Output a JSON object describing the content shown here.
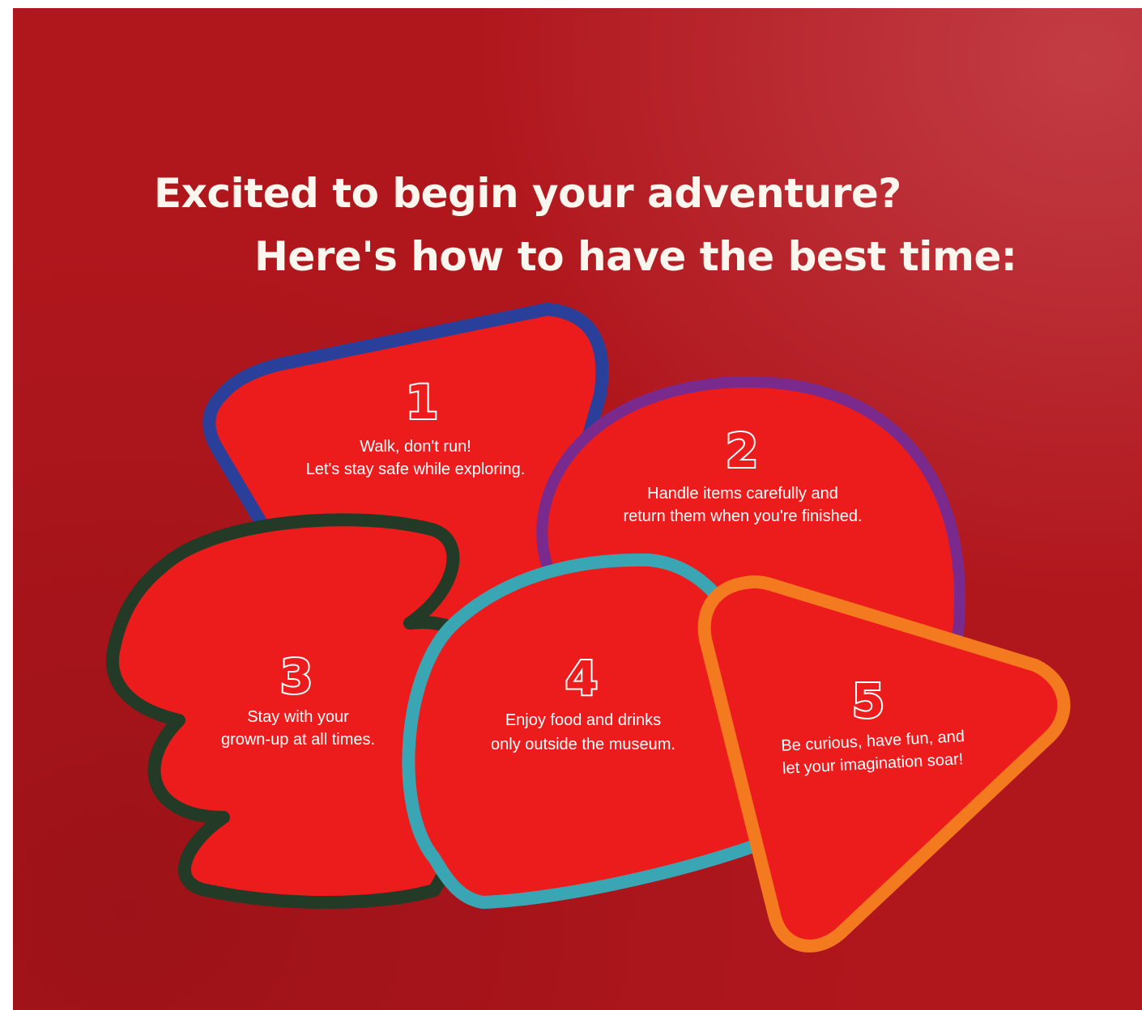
{
  "heading": {
    "line1": "Excited to begin your adventure?",
    "line2": "Here's how to have the best time:"
  },
  "rules": [
    {
      "number": "1",
      "line1": "Walk, don't run!",
      "line2": "Let's stay safe while exploring.",
      "border_color": "#2a3f9a"
    },
    {
      "number": "2",
      "line1": "Handle items carefully and",
      "line2": "return them when you're finished.",
      "border_color": "#7a2a8c"
    },
    {
      "number": "3",
      "line1": "Stay with your",
      "line2": "grown-up at all times.",
      "border_color": "#233a26"
    },
    {
      "number": "4",
      "line1": "Enjoy food and drinks",
      "line2": "only outside the museum.",
      "border_color": "#3aa6b4"
    },
    {
      "number": "5",
      "line1": "Be curious, have fun, and",
      "line2": "let your imagination soar!",
      "border_color": "#f47a1f"
    }
  ],
  "colors": {
    "wall": "#b0171d",
    "shape_fill": "#ed1c1c",
    "text": "#ffffff"
  }
}
